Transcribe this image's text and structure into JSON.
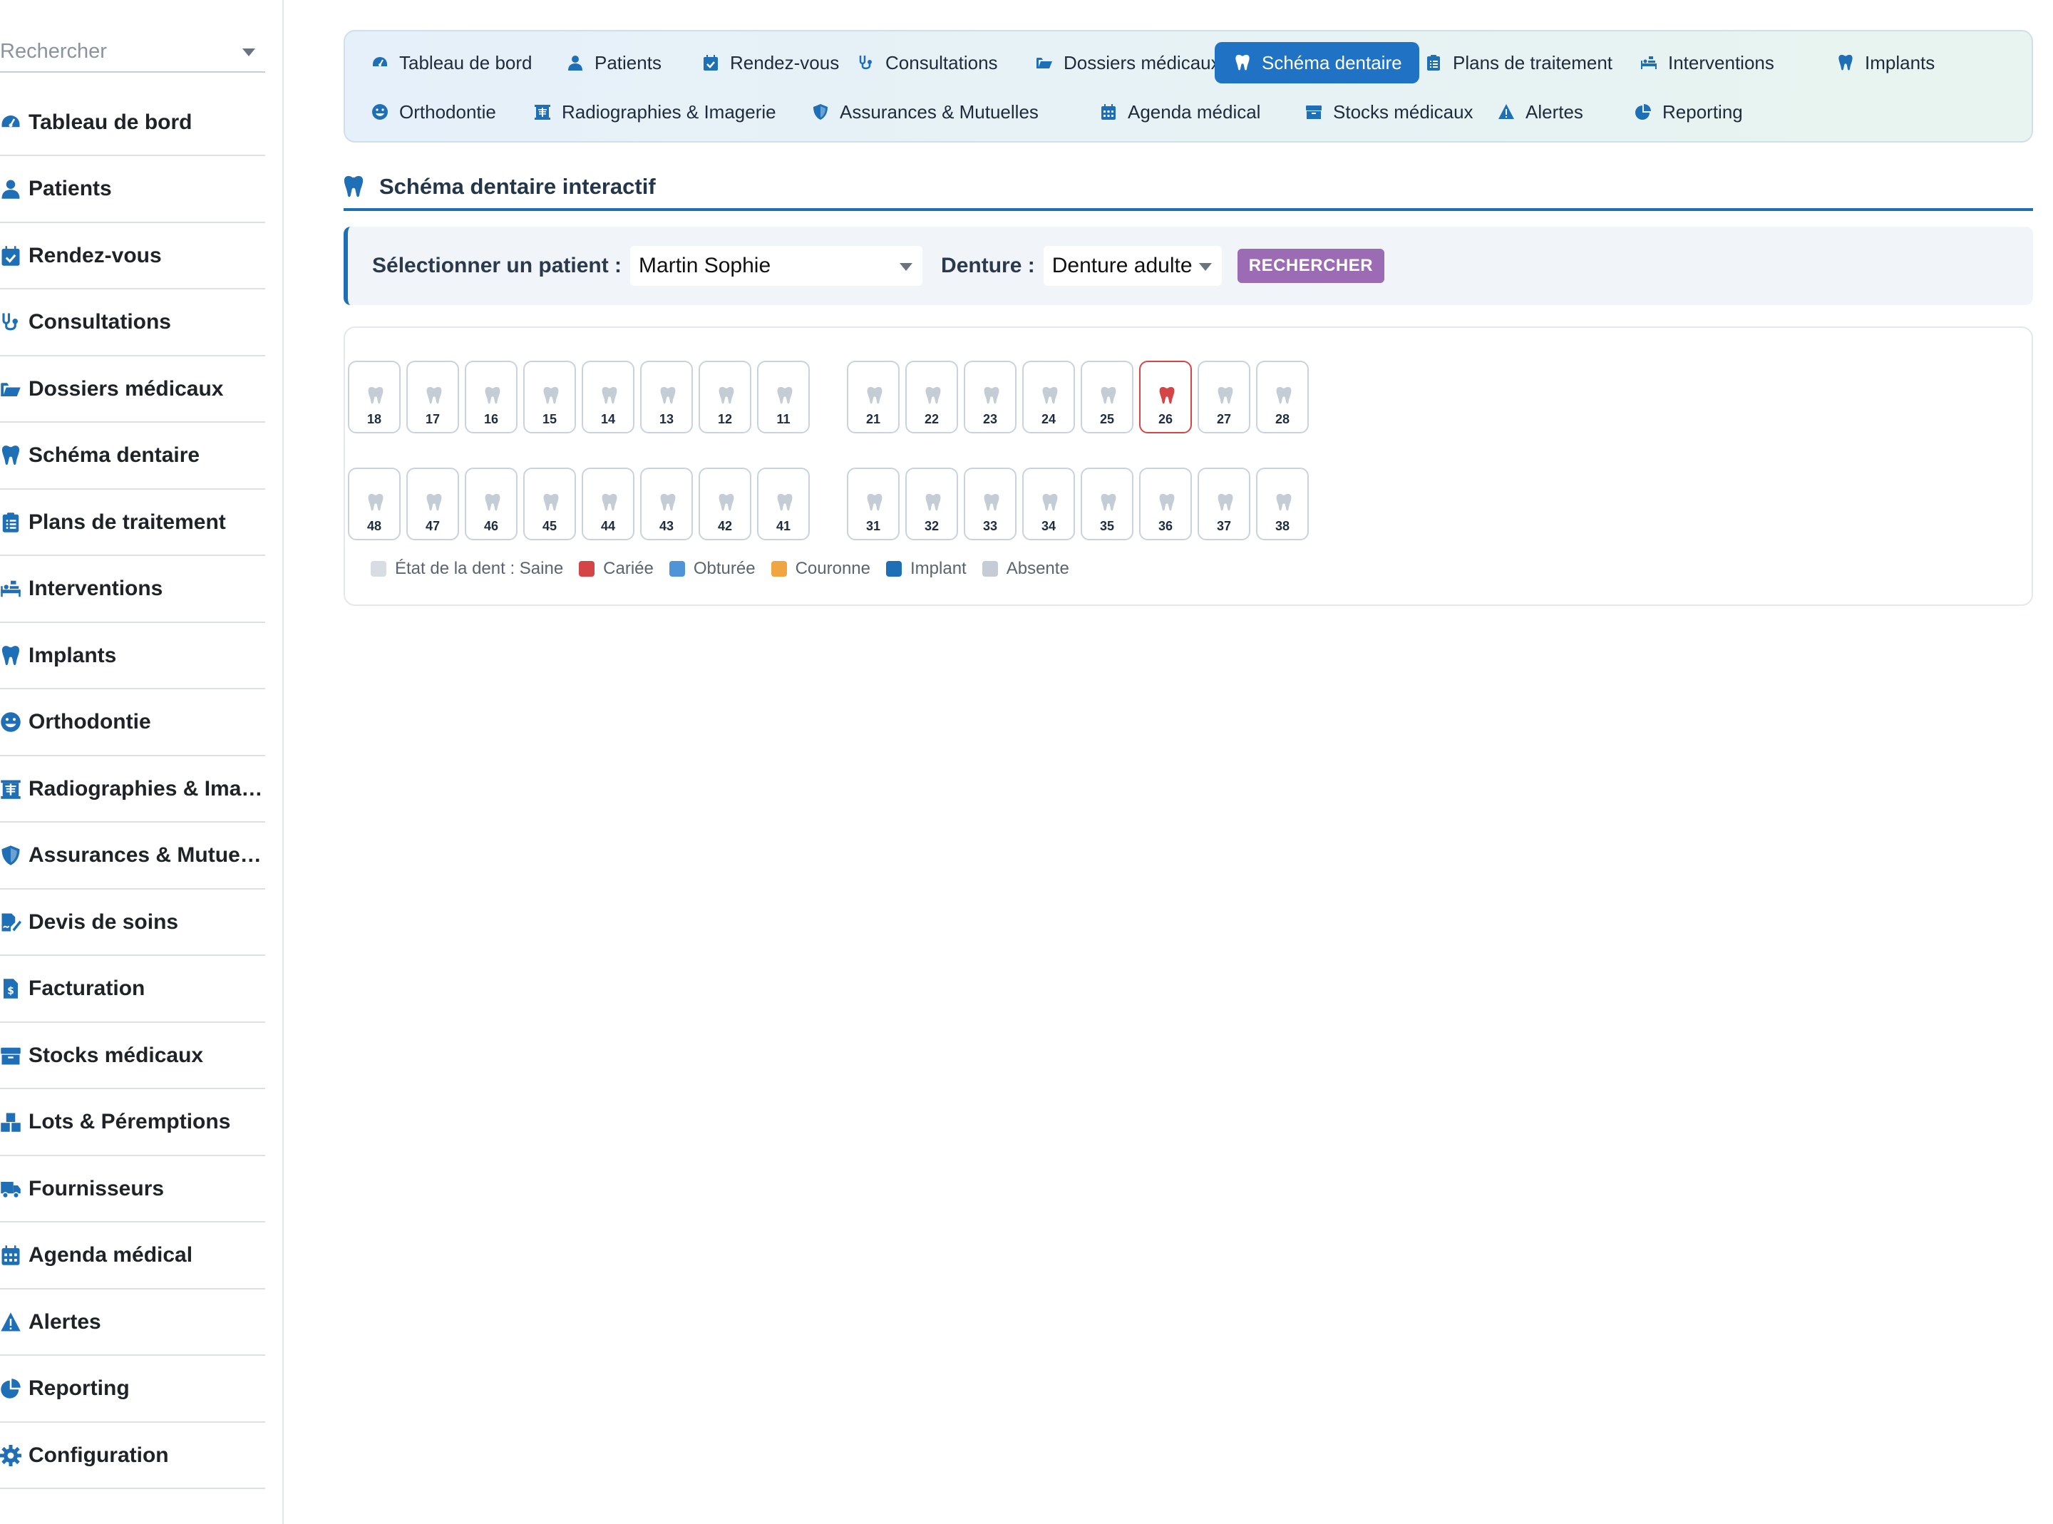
{
  "sidebar": {
    "search_placeholder": "Rechercher",
    "items": [
      {
        "label": "Tableau de bord",
        "icon": "dashboard-icon"
      },
      {
        "label": "Patients",
        "icon": "user-icon"
      },
      {
        "label": "Rendez-vous",
        "icon": "calendar-check-icon"
      },
      {
        "label": "Consultations",
        "icon": "stethoscope-icon"
      },
      {
        "label": "Dossiers médicaux",
        "icon": "folder-open-icon"
      },
      {
        "label": "Schéma dentaire",
        "icon": "tooth-icon"
      },
      {
        "label": "Plans de traitement",
        "icon": "clipboard-list-icon"
      },
      {
        "label": "Interventions",
        "icon": "procedure-bed-icon"
      },
      {
        "label": "Implants",
        "icon": "tooth-icon"
      },
      {
        "label": "Orthodontie",
        "icon": "smile-icon"
      },
      {
        "label": "Radiographies & Imagerie",
        "icon": "x-ray-icon"
      },
      {
        "label": "Assurances & Mutuelles",
        "icon": "shield-icon"
      },
      {
        "label": "Devis de soins",
        "icon": "file-signature-icon"
      },
      {
        "label": "Facturation",
        "icon": "invoice-dollar-icon"
      },
      {
        "label": "Stocks médicaux",
        "icon": "box-icon"
      },
      {
        "label": "Lots & Péremptions",
        "icon": "boxes-icon"
      },
      {
        "label": "Fournisseurs",
        "icon": "truck-icon"
      },
      {
        "label": "Agenda médical",
        "icon": "calendar-icon"
      },
      {
        "label": "Alertes",
        "icon": "warning-icon"
      },
      {
        "label": "Reporting",
        "icon": "pie-chart-icon"
      },
      {
        "label": "Configuration",
        "icon": "gear-icon"
      }
    ]
  },
  "topnav": {
    "tabs": [
      {
        "label": "Tableau de bord",
        "icon": "dashboard-icon",
        "active": false
      },
      {
        "label": "Patients",
        "icon": "user-icon",
        "active": false
      },
      {
        "label": "Rendez-vous",
        "icon": "calendar-check-icon",
        "active": false
      },
      {
        "label": "Consultations",
        "icon": "stethoscope-icon",
        "active": false
      },
      {
        "label": "Dossiers médicaux",
        "icon": "folder-open-icon",
        "active": false
      },
      {
        "label": "Schéma dentaire",
        "icon": "tooth-icon",
        "active": true
      },
      {
        "label": "Plans de traitement",
        "icon": "clipboard-list-icon",
        "active": false
      },
      {
        "label": "Interventions",
        "icon": "procedure-bed-icon",
        "active": false
      },
      {
        "label": "Implants",
        "icon": "tooth-icon",
        "active": false
      },
      {
        "label": "Orthodontie",
        "icon": "smile-icon",
        "active": false
      },
      {
        "label": "Radiographies & Imagerie",
        "icon": "x-ray-icon",
        "active": false
      },
      {
        "label": "Assurances & Mutuelles",
        "icon": "shield-icon",
        "active": false
      },
      {
        "label": "Agenda médical",
        "icon": "calendar-icon",
        "active": false
      },
      {
        "label": "Stocks médicaux",
        "icon": "box-icon",
        "active": false
      },
      {
        "label": "Alertes",
        "icon": "warning-icon",
        "active": false
      },
      {
        "label": "Reporting",
        "icon": "pie-chart-icon",
        "active": false
      }
    ]
  },
  "section": {
    "title": "Schéma dentaire interactif",
    "icon": "tooth-icon"
  },
  "filter": {
    "patient_label": "Sélectionner un patient :",
    "patient_value": "Martin Sophie",
    "denture_label": "Denture :",
    "denture_value": "Denture adulte",
    "search_button": "RECHERCHER"
  },
  "odontogram": {
    "upper_right": [
      {
        "num": "18",
        "state": "saine"
      },
      {
        "num": "17",
        "state": "saine"
      },
      {
        "num": "16",
        "state": "saine"
      },
      {
        "num": "15",
        "state": "saine"
      },
      {
        "num": "14",
        "state": "saine"
      },
      {
        "num": "13",
        "state": "saine"
      },
      {
        "num": "12",
        "state": "saine"
      },
      {
        "num": "11",
        "state": "saine"
      }
    ],
    "upper_left": [
      {
        "num": "21",
        "state": "saine"
      },
      {
        "num": "22",
        "state": "saine"
      },
      {
        "num": "23",
        "state": "saine"
      },
      {
        "num": "24",
        "state": "saine"
      },
      {
        "num": "25",
        "state": "saine"
      },
      {
        "num": "26",
        "state": "cariee"
      },
      {
        "num": "27",
        "state": "saine"
      },
      {
        "num": "28",
        "state": "saine"
      }
    ],
    "lower_right": [
      {
        "num": "48",
        "state": "saine"
      },
      {
        "num": "47",
        "state": "saine"
      },
      {
        "num": "46",
        "state": "saine"
      },
      {
        "num": "45",
        "state": "saine"
      },
      {
        "num": "44",
        "state": "saine"
      },
      {
        "num": "43",
        "state": "saine"
      },
      {
        "num": "42",
        "state": "saine"
      },
      {
        "num": "41",
        "state": "saine"
      }
    ],
    "lower_left": [
      {
        "num": "31",
        "state": "saine"
      },
      {
        "num": "32",
        "state": "saine"
      },
      {
        "num": "33",
        "state": "saine"
      },
      {
        "num": "34",
        "state": "saine"
      },
      {
        "num": "35",
        "state": "saine"
      },
      {
        "num": "36",
        "state": "saine"
      },
      {
        "num": "37",
        "state": "saine"
      },
      {
        "num": "38",
        "state": "saine"
      }
    ],
    "legend": [
      {
        "label": "État de la dent : Saine",
        "color": "#d7dde3"
      },
      {
        "label": "Cariée",
        "color": "#d64545"
      },
      {
        "label": "Obturée",
        "color": "#4f93d8"
      },
      {
        "label": "Couronne",
        "color": "#f0a640"
      },
      {
        "label": "Implant",
        "color": "#1f6fb6"
      },
      {
        "label": "Absente",
        "color": "#c5ccd6"
      }
    ]
  },
  "colors": {
    "accent": "#1f72c4",
    "button": "#9b6bb3",
    "caries": "#d64545",
    "healthy_tooth": "#c4ccd6"
  }
}
